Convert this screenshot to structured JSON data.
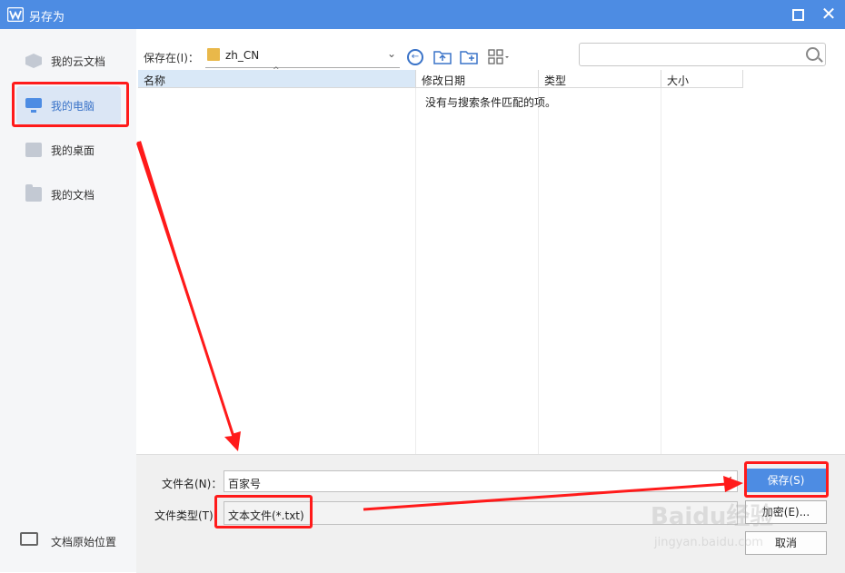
{
  "window": {
    "title": "另存为"
  },
  "sidebar": {
    "items": [
      {
        "label": "我的云文档",
        "icon": "cloud-doc-icon"
      },
      {
        "label": "我的电脑",
        "icon": "computer-icon",
        "active": true
      },
      {
        "label": "我的桌面",
        "icon": "desktop-icon"
      },
      {
        "label": "我的文档",
        "icon": "folder-icon"
      }
    ],
    "origin_location": "文档原始位置"
  },
  "toolbar": {
    "save_in_label": "保存在(I)：",
    "location": "zh_CN"
  },
  "search": {
    "placeholder": ""
  },
  "file_list": {
    "columns": [
      "名称",
      "修改日期",
      "类型",
      "大小"
    ],
    "empty_message": "没有与搜索条件匹配的项。"
  },
  "form": {
    "filename_label": "文件名(N)：",
    "filename_value": "百家号",
    "filetype_label": "文件类型(T)：",
    "filetype_value": "文本文件(*.txt)"
  },
  "buttons": {
    "save": "保存(S)",
    "encrypt": "加密(E)...",
    "cancel": "取消"
  },
  "watermark": {
    "brand": "Baidu经验",
    "url": "jingyan.baidu.com"
  },
  "colors": {
    "accent": "#4d8ce3",
    "annotation": "#ff1a1a"
  }
}
